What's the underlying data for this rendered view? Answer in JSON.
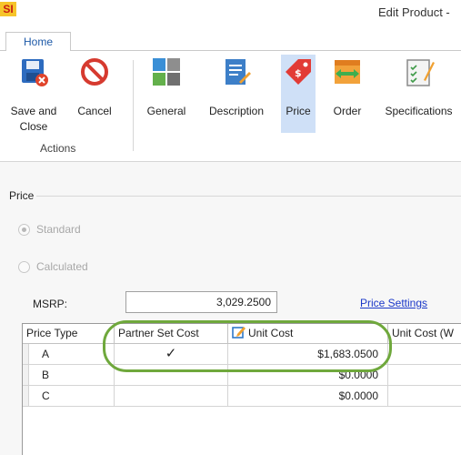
{
  "app": {
    "logo_text": "SI",
    "window_title": "Edit Product -"
  },
  "tabs": [
    {
      "label": "Home",
      "selected": true
    }
  ],
  "ribbon": {
    "buttons": [
      {
        "label": "Save and Close",
        "icon": "save-close-icon"
      },
      {
        "label": "Cancel",
        "icon": "cancel-icon"
      },
      {
        "label": "General",
        "icon": "general-icon"
      },
      {
        "label": "Description",
        "icon": "description-icon"
      },
      {
        "label": "Price",
        "icon": "price-tag-icon",
        "active": true
      },
      {
        "label": "Order",
        "icon": "order-icon"
      },
      {
        "label": "Specifications",
        "icon": "specifications-icon"
      }
    ],
    "group_label": "Actions"
  },
  "price": {
    "section_title": "Price",
    "radio_standard": "Standard",
    "radio_calculated": "Calculated",
    "selected_mode": "Standard",
    "msrp_label": "MSRP:",
    "msrp_value": "3,029.2500",
    "price_settings_link": "Price Settings"
  },
  "grid": {
    "columns": [
      "Price Type",
      "Partner Set Cost",
      "Unit Cost",
      "Unit Cost (W"
    ],
    "rows": [
      {
        "price_type": "A",
        "partner_set_cost": "✓",
        "unit_cost": "$1,683.0500"
      },
      {
        "price_type": "B",
        "partner_set_cost": "",
        "unit_cost": "$0.0000"
      },
      {
        "price_type": "C",
        "partner_set_cost": "",
        "unit_cost": "$0.0000"
      }
    ]
  },
  "colors": {
    "highlight": "#6fa83c",
    "link": "#1a38c8",
    "active_ribbon": "#cfe0f7"
  }
}
